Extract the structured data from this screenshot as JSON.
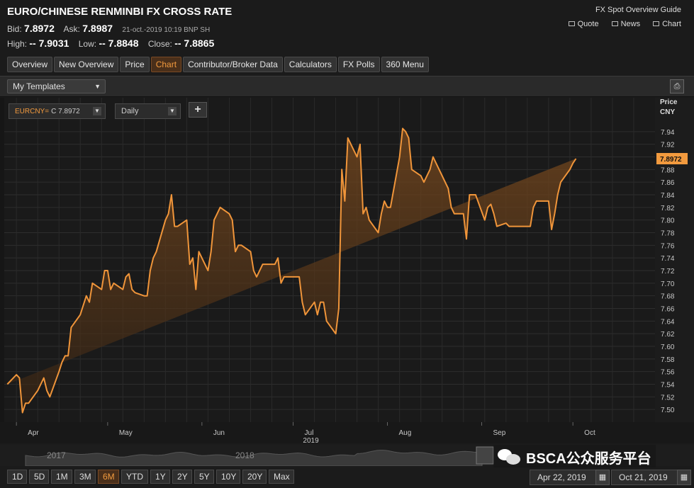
{
  "header": {
    "title": "EURO/CHINESE RENMINBI FX CROSS RATE",
    "bid_label": "Bid:",
    "bid": "7.8972",
    "ask_label": "Ask:",
    "ask": "7.8987",
    "timestamp": "21-oct.-2019  10:19 BNP SH",
    "high_label": "High:",
    "high": "-- 7.9031",
    "low_label": "Low:",
    "low": "-- 7.8848",
    "close_label": "Close:",
    "close": "-- 7.8865",
    "guide_link": "FX Spot Overview Guide",
    "links": [
      "Quote",
      "News",
      "Chart"
    ]
  },
  "tabs": [
    {
      "label": "Overview",
      "active": false
    },
    {
      "label": "New Overview",
      "active": false
    },
    {
      "label": "Price",
      "active": false
    },
    {
      "label": "Chart",
      "active": true
    },
    {
      "label": "Contributor/Broker Data",
      "active": false
    },
    {
      "label": "Calculators",
      "active": false
    },
    {
      "label": "FX Polls",
      "active": false
    },
    {
      "label": "360 Menu",
      "active": false
    }
  ],
  "toolbar": {
    "templates": "My Templates"
  },
  "chart_controls": {
    "ric": "EURCNY=",
    "ric_value": "C 7.8972",
    "interval": "Daily",
    "add": "+"
  },
  "chart_data": {
    "type": "area",
    "ylabel": "Price",
    "yunit": "CNY",
    "ylim": [
      7.48,
      7.96
    ],
    "yticks": [
      "7.94",
      "7.92",
      "7.90",
      "7.88",
      "7.86",
      "7.84",
      "7.82",
      "7.80",
      "7.78",
      "7.76",
      "7.74",
      "7.72",
      "7.70",
      "7.68",
      "7.66",
      "7.64",
      "7.62",
      "7.60",
      "7.58",
      "7.56",
      "7.54",
      "7.52",
      "7.50"
    ],
    "month_labels": [
      "Apr",
      "May",
      "Jun",
      "Jul",
      "Aug",
      "Sep",
      "Oct"
    ],
    "year_label": "2019",
    "last_value_label": "7.8972",
    "line_color": "#f0953a",
    "x": [
      "2019-03-29",
      "2019-04-01",
      "2019-04-02",
      "2019-04-03",
      "2019-04-04",
      "2019-04-05",
      "2019-04-08",
      "2019-04-09",
      "2019-04-10",
      "2019-04-11",
      "2019-04-12",
      "2019-04-15",
      "2019-04-16",
      "2019-04-17",
      "2019-04-18",
      "2019-04-19",
      "2019-04-22",
      "2019-04-23",
      "2019-04-24",
      "2019-04-25",
      "2019-04-26",
      "2019-04-29",
      "2019-04-30",
      "2019-05-01",
      "2019-05-02",
      "2019-05-03",
      "2019-05-06",
      "2019-05-07",
      "2019-05-08",
      "2019-05-09",
      "2019-05-10",
      "2019-05-13",
      "2019-05-14",
      "2019-05-15",
      "2019-05-16",
      "2019-05-17",
      "2019-05-20",
      "2019-05-21",
      "2019-05-22",
      "2019-05-23",
      "2019-05-24",
      "2019-05-27",
      "2019-05-28",
      "2019-05-29",
      "2019-05-30",
      "2019-05-31",
      "2019-06-03",
      "2019-06-04",
      "2019-06-05",
      "2019-06-06",
      "2019-06-07",
      "2019-06-10",
      "2019-06-11",
      "2019-06-12",
      "2019-06-13",
      "2019-06-14",
      "2019-06-17",
      "2019-06-18",
      "2019-06-19",
      "2019-06-20",
      "2019-06-21",
      "2019-06-24",
      "2019-06-25",
      "2019-06-26",
      "2019-06-27",
      "2019-06-28",
      "2019-07-01",
      "2019-07-02",
      "2019-07-03",
      "2019-07-04",
      "2019-07-05",
      "2019-07-08",
      "2019-07-09",
      "2019-07-10",
      "2019-07-11",
      "2019-07-12",
      "2019-07-15",
      "2019-07-16",
      "2019-07-17",
      "2019-07-18",
      "2019-07-19",
      "2019-07-22",
      "2019-07-23",
      "2019-07-24",
      "2019-07-25",
      "2019-07-26",
      "2019-07-29",
      "2019-07-30",
      "2019-07-31",
      "2019-08-01",
      "2019-08-02",
      "2019-08-05",
      "2019-08-06",
      "2019-08-07",
      "2019-08-08",
      "2019-08-09",
      "2019-08-12",
      "2019-08-13",
      "2019-08-14",
      "2019-08-15",
      "2019-08-16",
      "2019-08-19",
      "2019-08-20",
      "2019-08-21",
      "2019-08-22",
      "2019-08-23",
      "2019-08-26",
      "2019-08-27",
      "2019-08-28",
      "2019-08-29",
      "2019-08-30",
      "2019-09-02",
      "2019-09-03",
      "2019-09-04",
      "2019-09-05",
      "2019-09-06",
      "2019-09-09",
      "2019-09-10",
      "2019-09-11",
      "2019-09-12",
      "2019-09-13",
      "2019-09-16",
      "2019-09-17",
      "2019-09-18",
      "2019-09-19",
      "2019-09-20",
      "2019-09-23",
      "2019-09-24",
      "2019-09-25",
      "2019-09-26",
      "2019-09-27",
      "2019-09-30",
      "2019-10-01",
      "2019-10-02",
      "2019-10-03",
      "2019-10-04",
      "2019-10-07",
      "2019-10-08",
      "2019-10-09",
      "2019-10-10",
      "2019-10-11",
      "2019-10-14",
      "2019-10-15",
      "2019-10-16",
      "2019-10-17",
      "2019-10-18",
      "2019-10-21"
    ],
    "values": [
      7.54,
      7.555,
      7.55,
      7.495,
      7.51,
      7.51,
      7.53,
      7.54,
      7.55,
      7.53,
      7.52,
      7.56,
      7.575,
      7.585,
      7.585,
      7.63,
      7.65,
      7.665,
      7.68,
      7.67,
      7.7,
      7.69,
      7.72,
      7.72,
      7.69,
      7.7,
      7.69,
      7.71,
      7.715,
      7.69,
      7.685,
      7.68,
      7.68,
      7.72,
      7.74,
      7.75,
      7.8,
      7.81,
      7.84,
      7.79,
      7.79,
      7.8,
      7.73,
      7.74,
      7.69,
      7.75,
      7.72,
      7.75,
      7.8,
      7.81,
      7.82,
      7.81,
      7.8,
      7.75,
      7.76,
      7.76,
      7.75,
      7.72,
      7.71,
      7.72,
      7.73,
      7.73,
      7.73,
      7.74,
      7.7,
      7.71,
      7.71,
      7.71,
      7.71,
      7.67,
      7.65,
      7.67,
      7.65,
      7.67,
      7.67,
      7.64,
      7.62,
      7.66,
      7.88,
      7.83,
      7.93,
      7.9,
      7.92,
      7.81,
      7.82,
      7.8,
      7.78,
      7.81,
      7.83,
      7.82,
      7.82,
      7.9,
      7.945,
      7.94,
      7.93,
      7.88,
      7.87,
      7.86,
      7.87,
      7.88,
      7.9,
      7.87,
      7.86,
      7.85,
      7.82,
      7.81,
      7.81,
      7.77,
      7.84,
      7.84,
      7.84,
      7.8,
      7.82,
      7.825,
      7.81,
      7.79,
      7.795,
      7.79,
      7.79,
      7.79,
      7.79,
      7.79,
      7.79,
      7.82,
      7.83,
      7.83,
      7.83,
      7.785,
      7.81,
      7.84,
      7.86,
      7.88,
      7.89,
      7.8972
    ]
  },
  "navigator": {
    "years": [
      "2017",
      "2018"
    ]
  },
  "range_buttons": [
    {
      "label": "1D",
      "active": false
    },
    {
      "label": "5D",
      "active": false
    },
    {
      "label": "1M",
      "active": false
    },
    {
      "label": "3M",
      "active": false
    },
    {
      "label": "6M",
      "active": true
    },
    {
      "label": "YTD",
      "active": false
    },
    {
      "label": "1Y",
      "active": false
    },
    {
      "label": "2Y",
      "active": false
    },
    {
      "label": "5Y",
      "active": false
    },
    {
      "label": "10Y",
      "active": false
    },
    {
      "label": "20Y",
      "active": false
    },
    {
      "label": "Max",
      "active": false
    }
  ],
  "date_range": {
    "start": "Apr 22, 2019",
    "end": "Oct 21, 2019"
  },
  "watermark": "BSCA公众服务平台"
}
